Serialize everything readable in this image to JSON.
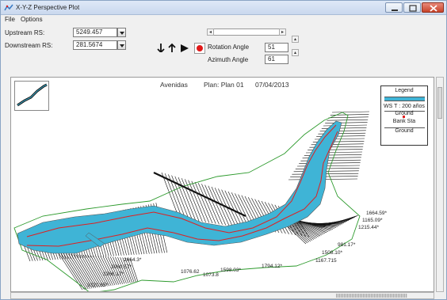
{
  "window": {
    "title": "X-Y-Z Perspective Plot"
  },
  "menu": [
    "File",
    "Options"
  ],
  "controls": {
    "upstream_label": "Upstream RS:",
    "upstream_value": "5249.457",
    "downstream_label": "Downstream RS:",
    "downstream_value": "281.5674",
    "rotation_label": "Rotation Angle",
    "rotation_value": "51",
    "azimuth_label": "Azimuth Angle",
    "azimuth_value": "61"
  },
  "plot": {
    "header_left": "Avenidas",
    "header_plan": "Plan: Plan 01",
    "header_date": "07/04/2013",
    "legend": {
      "title": "Legend",
      "ws": "WS T : 200 años",
      "ground": "Ground",
      "bank": "Bank Sta",
      "ground2": "Ground"
    },
    "station_labels": [
      "1664.59*",
      "1165.09*",
      "1215.44*",
      "981.17*",
      "1508.10*",
      "1167.715",
      "1076.62",
      "1598.03*",
      "1794.12*",
      "1073.8",
      "2664.3*",
      "3080.57*",
      "3366.17*",
      "3320.85*"
    ]
  },
  "colors": {
    "water": "#3fb4d6",
    "bank": "#e02020",
    "ground": "#2c9a2c"
  }
}
